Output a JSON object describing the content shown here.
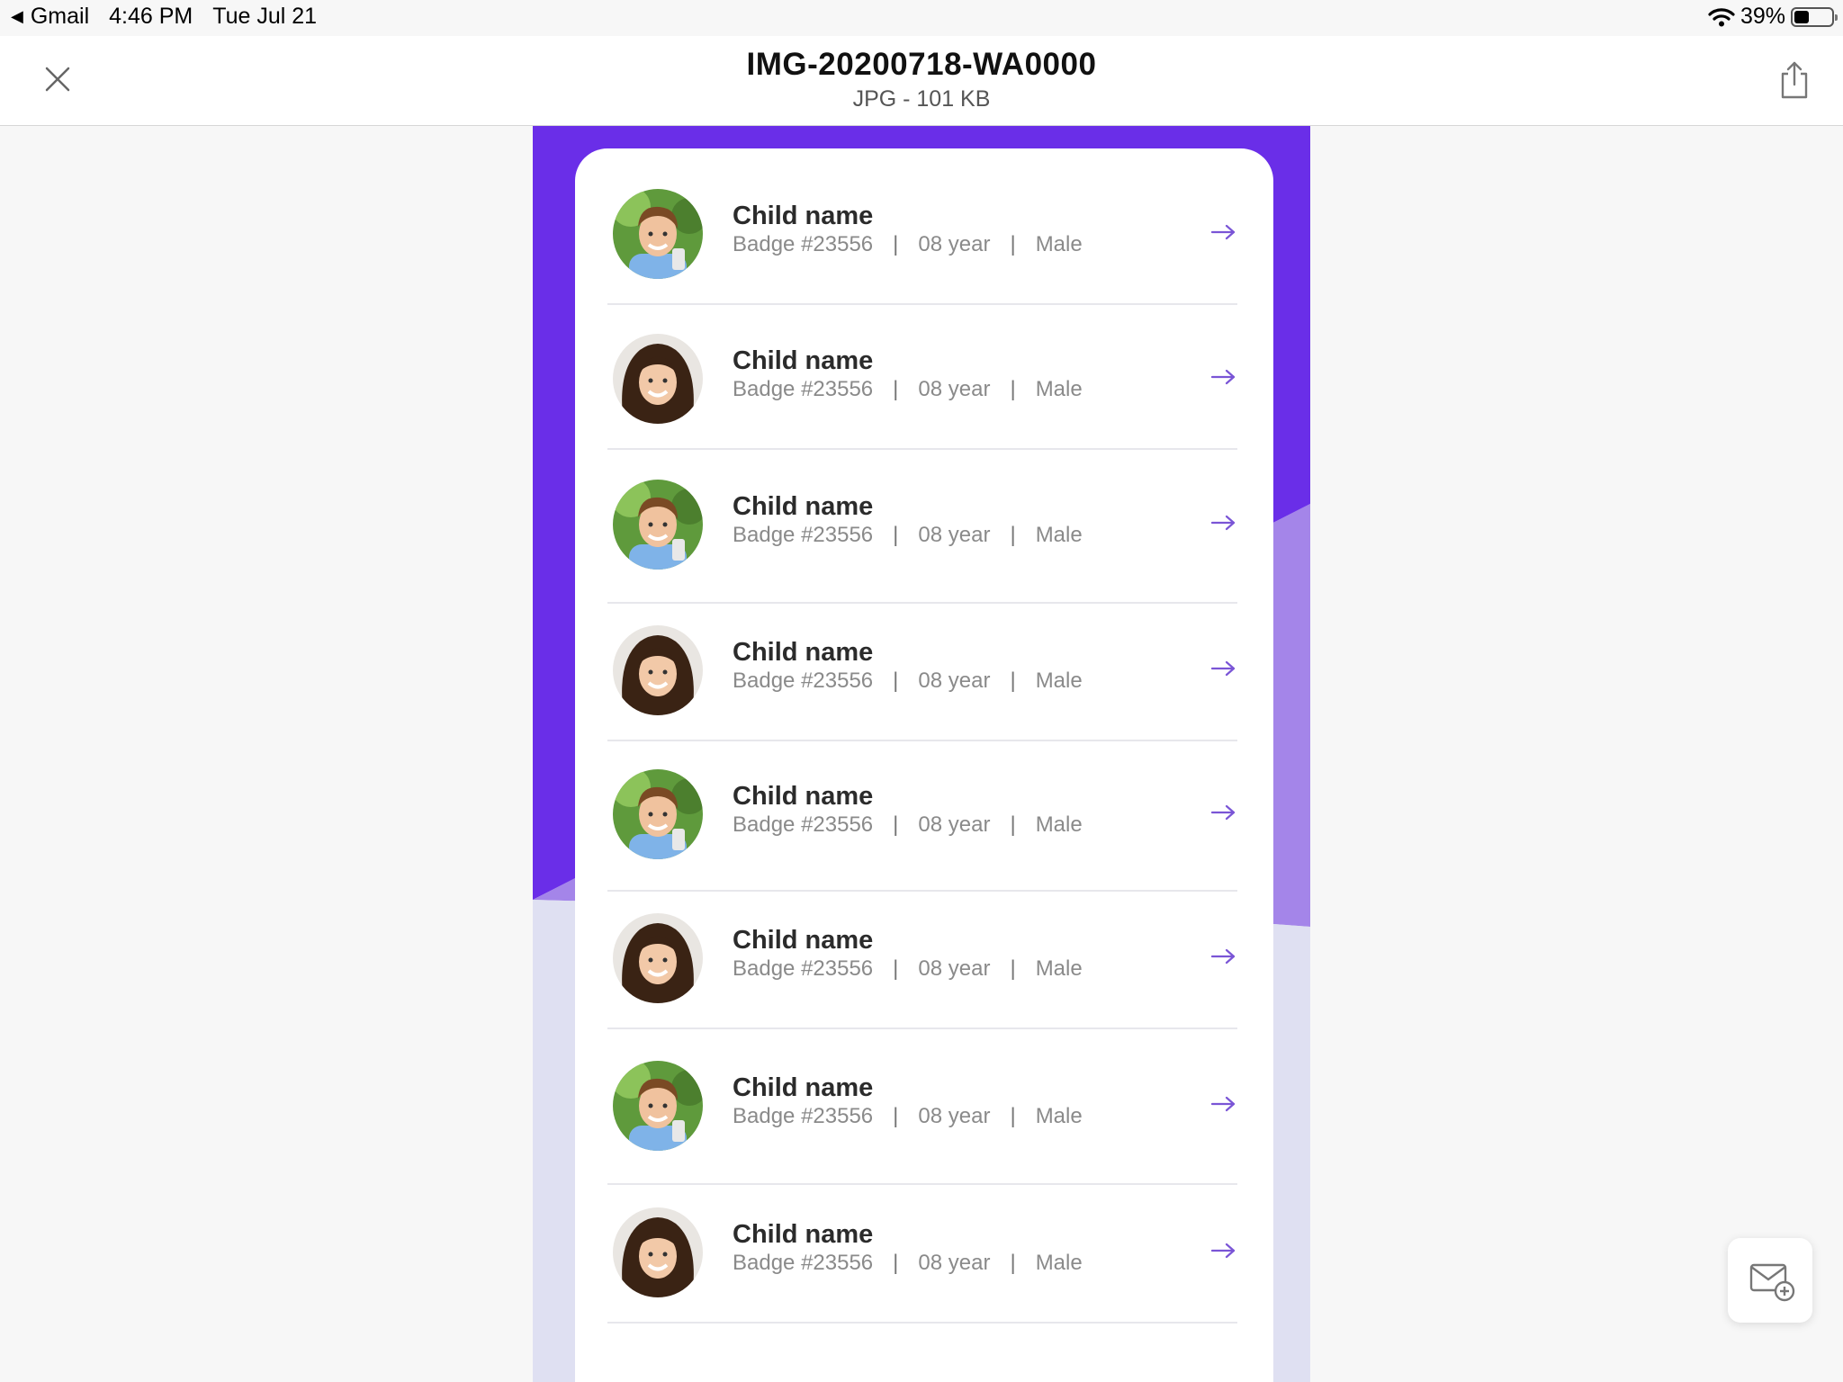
{
  "status_bar": {
    "back_app": "Gmail",
    "time": "4:46 PM",
    "date": "Tue Jul 21",
    "battery_text": "39%",
    "battery_level": 0.39
  },
  "navbar": {
    "title": "IMG-20200718-WA0000",
    "subtitle": "JPG - 101 KB",
    "close_icon": "close-icon",
    "share_icon": "share-icon"
  },
  "colors": {
    "purple": "#6a2ee8",
    "purple_light": "#a07fe8",
    "lavender_bg": "#dfe0f2",
    "arrow": "#7a55d6"
  },
  "children": [
    {
      "name": "Child name",
      "badge": "Badge #23556",
      "age": "08 year",
      "gender": "Male",
      "avatar": "boy"
    },
    {
      "name": "Child name",
      "badge": "Badge #23556",
      "age": "08 year",
      "gender": "Male",
      "avatar": "girl"
    },
    {
      "name": "Child name",
      "badge": "Badge #23556",
      "age": "08 year",
      "gender": "Male",
      "avatar": "boy"
    },
    {
      "name": "Child name",
      "badge": "Badge #23556",
      "age": "08 year",
      "gender": "Male",
      "avatar": "girl"
    },
    {
      "name": "Child name",
      "badge": "Badge #23556",
      "age": "08 year",
      "gender": "Male",
      "avatar": "boy"
    },
    {
      "name": "Child name",
      "badge": "Badge #23556",
      "age": "08 year",
      "gender": "Male",
      "avatar": "girl"
    },
    {
      "name": "Child name",
      "badge": "Badge #23556",
      "age": "08 year",
      "gender": "Male",
      "avatar": "boy"
    },
    {
      "name": "Child name",
      "badge": "Badge #23556",
      "age": "08 year",
      "gender": "Male",
      "avatar": "girl"
    }
  ],
  "compose_icon": "compose-mail-icon"
}
